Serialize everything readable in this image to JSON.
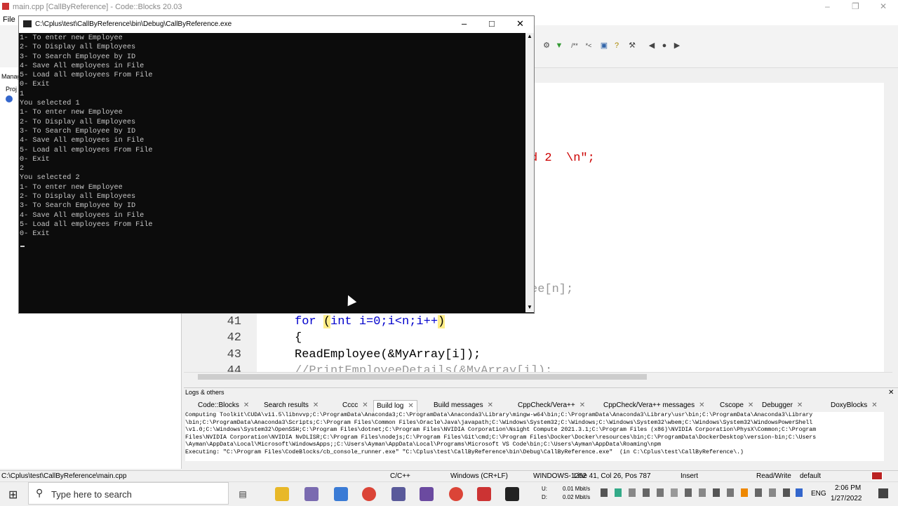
{
  "ide": {
    "title": "main.cpp [CallByReference] - Code::Blocks 20.03",
    "menu_file": "File",
    "left_tab_manage": "Manag",
    "left_tab_projects": "Proj"
  },
  "editor": {
    "lines": [
      {
        "num": "41",
        "code_a": "for ",
        "code_b": "(",
        "code_c": "int i=0;i<n;i++",
        "code_d": ")"
      },
      {
        "num": "42",
        "code": "{"
      },
      {
        "num": "43",
        "code": "ReadEmployee(&MyArray[i]);"
      },
      {
        "num": "44",
        "code": "//PrintEmployeeDetails(&MyArray[i]);"
      }
    ],
    "partial_string": "d 2  \\n\";",
    "partial_decl": "ee[n];"
  },
  "console": {
    "title": "C:\\Cplus\\test\\CallByReference\\bin\\Debug\\CallByReference.exe",
    "lines": [
      "1- To enter new Employee",
      "2- To Display all Employees",
      "3- To Search Employee by ID",
      "4- Save All employees in File",
      "5- Load all employees From File",
      "0- Exit",
      "1",
      "You selected 1",
      "1- To enter new Employee",
      "2- To Display all Employees",
      "3- To Search Employee by ID",
      "4- Save All employees in File",
      "5- Load all employees From File",
      "0- Exit",
      "2",
      "You selected 2",
      "1- To enter new Employee",
      "2- To Display all Employees",
      "3- To Search Employee by ID",
      "4- Save All employees in File",
      "5- Load all employees From File",
      "0- Exit"
    ]
  },
  "logs": {
    "title": "Logs & others",
    "tabs": [
      "Code::Blocks",
      "Search results",
      "Cccc",
      "Build log",
      "Build messages",
      "CppCheck/Vera++",
      "CppCheck/Vera++ messages",
      "Cscope",
      "Debugger",
      "DoxyBlocks"
    ],
    "body": [
      "Computing Toolkit\\CUDA\\v11.5\\libnvvp;C:\\ProgramData\\Anaconda3;C:\\ProgramData\\Anaconda3\\Library\\mingw-w64\\bin;C:\\ProgramData\\Anaconda3\\Library\\usr\\bin;C:\\ProgramData\\Anaconda3\\Library",
      "\\bin;C:\\ProgramData\\Anaconda3\\Scripts;C:\\Program Files\\Common Files\\Oracle\\Java\\javapath;C:\\Windows\\System32;C:\\Windows;C:\\Windows\\System32\\wbem;C:\\Windows\\System32\\WindowsPowerShell",
      "\\v1.0;C:\\Windows\\System32\\OpenSSH;C:\\Program Files\\dotnet;C:\\Program Files\\NVIDIA Corporation\\Nsight Compute 2021.3.1;C:\\Program Files (x86)\\NVIDIA Corporation\\PhysX\\Common;C:\\Program",
      "Files\\NVIDIA Corporation\\NVIDIA NvDLISR;C:\\Program Files\\nodejs;C:\\Program Files\\Git\\cmd;C:\\Program Files\\Docker\\Docker\\resources\\bin;C:\\ProgramData\\DockerDesktop\\version-bin;C:\\Users",
      "\\Ayman\\AppData\\Local\\Microsoft\\WindowsApps;;C:\\Users\\Ayman\\AppData\\Local\\Programs\\Microsoft VS Code\\bin;C:\\Users\\Ayman\\AppData\\Roaming\\npm",
      "Executing: \"C:\\Program Files\\CodeBlocks/cb_console_runner.exe\" \"C:\\Cplus\\test\\CallByReference\\bin\\Debug\\CallByReference.exe\"  (in C:\\Cplus\\test\\CallByReference\\.)"
    ]
  },
  "status": {
    "path": "C:\\Cplus\\test\\CallByReference\\main.cpp",
    "lang": "C/C++",
    "eol": "Windows (CR+LF)",
    "encoding": "WINDOWS-1252",
    "position": "Line 41, Col 26, Pos 787",
    "mode": "Insert",
    "access": "Read/Write",
    "profile": "default"
  },
  "taskbar": {
    "search_placeholder": "Type here to search",
    "net_up": "0.01 Mbit/s",
    "net_down": "0.02 Mbit/s",
    "net_u": "U:",
    "net_d": "D:",
    "lang": "ENG",
    "time": "2:06 PM",
    "date": "1/27/2022"
  }
}
